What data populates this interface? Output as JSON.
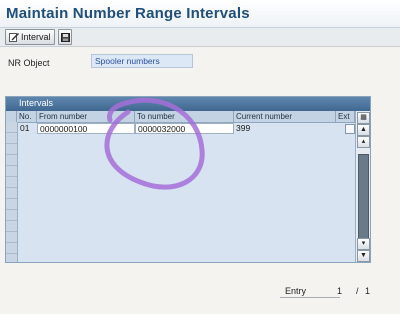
{
  "window": {
    "title": "Maintain Number Range Intervals"
  },
  "toolbar": {
    "interval_label": "Interval",
    "interval_icon": "edit-icon",
    "save_icon": "save-icon"
  },
  "nr_object": {
    "label": "NR Object",
    "value": "Spooler numbers"
  },
  "intervals": {
    "title": "Intervals",
    "columns": [
      "No.",
      "From number",
      "To number",
      "Current number",
      "Ext"
    ],
    "rows": [
      {
        "no": "01",
        "from": "0000000100",
        "to": "0000032000",
        "current": "399",
        "ext": false
      }
    ]
  },
  "footer": {
    "entry_label": "Entry",
    "entry_current": "1",
    "separator": "/",
    "entry_total": "1"
  },
  "colors": {
    "title": "#1f4f7a",
    "grid_header": "#3f6790",
    "annotation": "#a56fd8"
  }
}
